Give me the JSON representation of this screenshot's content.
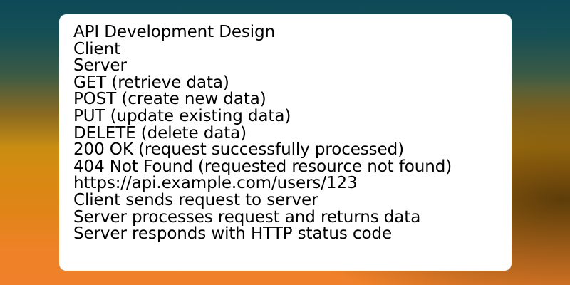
{
  "colors": {
    "card_background": "#ffffff",
    "text": "#000000",
    "background_top": "#0d4a58",
    "background_middle": "#d68a12",
    "background_bottom": "#f0802a"
  },
  "content": {
    "title": "API Development Design",
    "lines": [
      "Client",
      "Server",
      "GET (retrieve data)",
      "POST (create new data)",
      "PUT (update existing data)",
      "DELETE (delete data)",
      "200 OK (request successfully processed)",
      "404 Not Found (requested resource not found)",
      "https://api.example.com/users/123",
      "Client sends request to server",
      "Server processes request and returns data",
      "Server responds with HTTP status code"
    ]
  }
}
